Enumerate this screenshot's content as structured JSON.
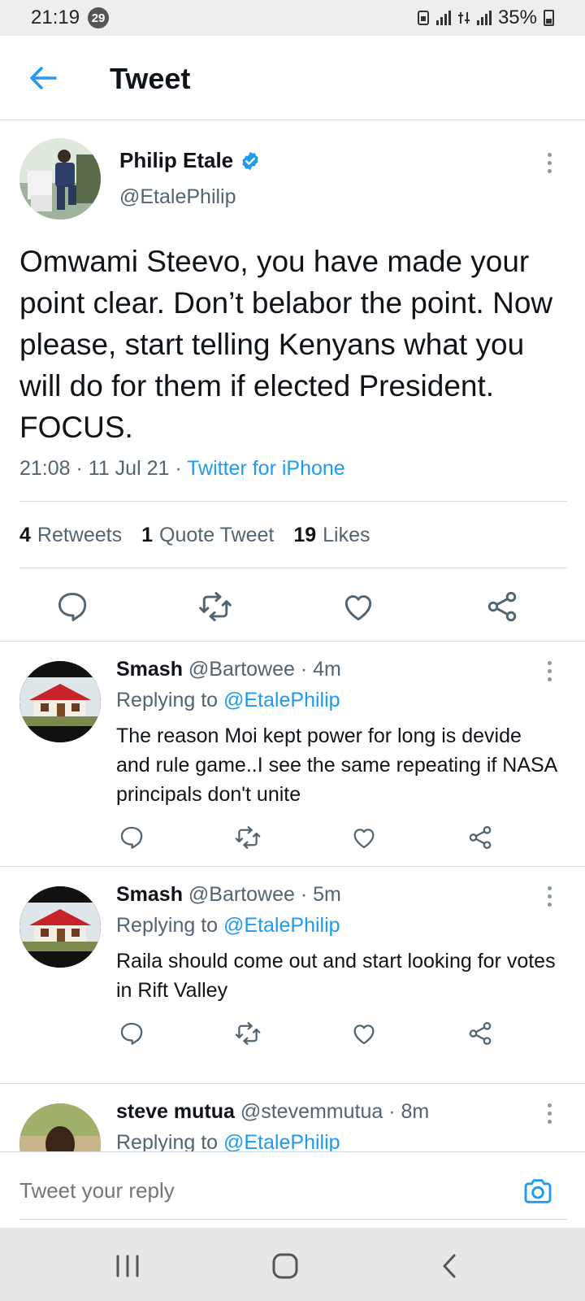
{
  "status_bar": {
    "time": "21:19",
    "notification_count": "29",
    "battery": "35%"
  },
  "header": {
    "title": "Tweet"
  },
  "tweet": {
    "author_name": "Philip Etale",
    "author_handle": "@EtalePhilip",
    "text": "Omwami Steevo, you have made your point clear. Don’t belabor the point. Now please, start telling Kenyans what you will do for them if elected President. FOCUS.",
    "timestamp": "21:08 · 11 Jul 21 · ",
    "source": "Twitter for iPhone",
    "stats": {
      "retweets_count": "4",
      "retweets_label": "Retweets",
      "quotes_count": "1",
      "quotes_label": "Quote Tweet",
      "likes_count": "19",
      "likes_label": "Likes"
    }
  },
  "replies": [
    {
      "name": "Smash",
      "meta": " @Bartowee · 4m",
      "replying_label": "Replying to ",
      "replying_handle": "@EtalePhilip",
      "text": "The reason Moi kept power for long is devide and rule game..I see the same repeating if NASA principals don't unite"
    },
    {
      "name": "Smash",
      "meta": " @Bartowee · 5m",
      "replying_label": "Replying to ",
      "replying_handle": "@EtalePhilip",
      "text": "Raila should come out and start looking for votes in Rift Valley"
    },
    {
      "name": "steve mutua",
      "meta": " @stevemmutua · 8m",
      "replying_label": "Replying to ",
      "replying_handle": "@EtalePhilip"
    }
  ],
  "reply_box": {
    "placeholder": "Tweet your reply"
  },
  "colors": {
    "accent": "#1d9bf0",
    "secondary_text": "#536471",
    "divider": "#d8dde1"
  },
  "icons": {
    "back": "arrow-left-icon",
    "verified": "verified-badge-icon",
    "reply": "reply-icon",
    "retweet": "retweet-icon",
    "like": "heart-icon",
    "share": "share-icon",
    "camera": "camera-icon",
    "more": "more-vertical-icon"
  }
}
